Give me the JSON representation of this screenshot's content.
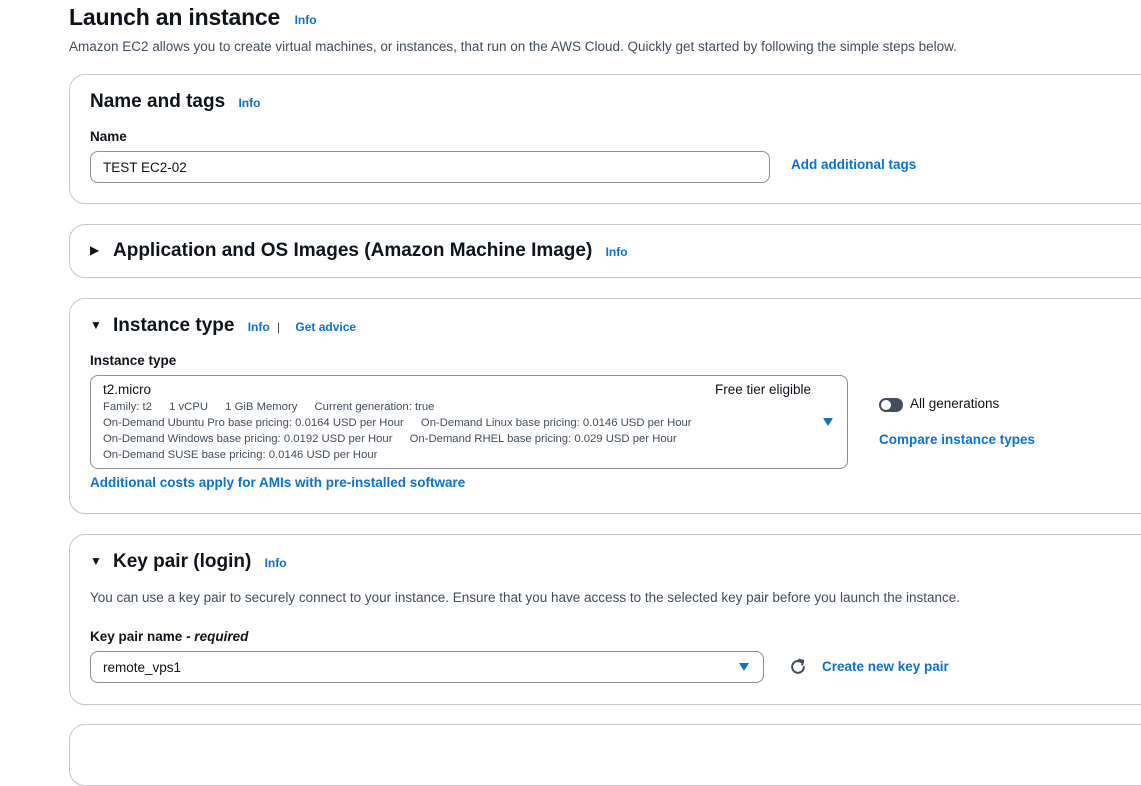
{
  "header": {
    "title": "Launch an instance",
    "info": "Info",
    "description": "Amazon EC2 allows you to create virtual machines, or instances, that run on the AWS Cloud. Quickly get started by following the simple steps below."
  },
  "name_tags": {
    "title": "Name and tags",
    "info": "Info",
    "name_label": "Name",
    "name_value": "TEST EC2-02",
    "add_tags_link": "Add additional tags"
  },
  "ami": {
    "title": "Application and OS Images (Amazon Machine Image)",
    "info": "Info",
    "expanded": false
  },
  "instance_type": {
    "title": "Instance type",
    "info": "Info",
    "separator": "|",
    "get_advice": "Get advice",
    "field_label": "Instance type",
    "selected": {
      "name": "t2.micro",
      "free_tier": "Free tier eligible",
      "family": "Family: t2",
      "vcpu": "1 vCPU",
      "memory": "1 GiB Memory",
      "current_generation": "Current generation: true",
      "ubuntu_pricing": "On-Demand Ubuntu Pro base pricing: 0.0164 USD per Hour",
      "linux_pricing": "On-Demand Linux base pricing: 0.0146 USD per Hour",
      "windows_pricing": "On-Demand Windows base pricing: 0.0192 USD per Hour",
      "rhel_pricing": "On-Demand RHEL base pricing: 0.029 USD per Hour",
      "suse_pricing": "On-Demand SUSE base pricing: 0.0146 USD per Hour"
    },
    "all_generations_label": "All generations",
    "all_generations_on": false,
    "compare_link": "Compare instance types",
    "additional_costs_link": "Additional costs apply for AMIs with pre-installed software"
  },
  "key_pair": {
    "title": "Key pair (login)",
    "info": "Info",
    "description": "You can use a key pair to securely connect to your instance. Ensure that you have access to the selected key pair before you launch the instance.",
    "label": "Key pair name",
    "required": "- required",
    "selected": "remote_vps1",
    "create_link": "Create new key pair"
  },
  "colors": {
    "link": "#0972d3",
    "text": "#0f141a",
    "secondary_text": "#414d5c",
    "border": "#c6c6cd"
  },
  "icons": [
    "caret-right-icon",
    "caret-down-icon",
    "dropdown-caret-icon",
    "refresh-icon",
    "toggle-switch"
  ]
}
